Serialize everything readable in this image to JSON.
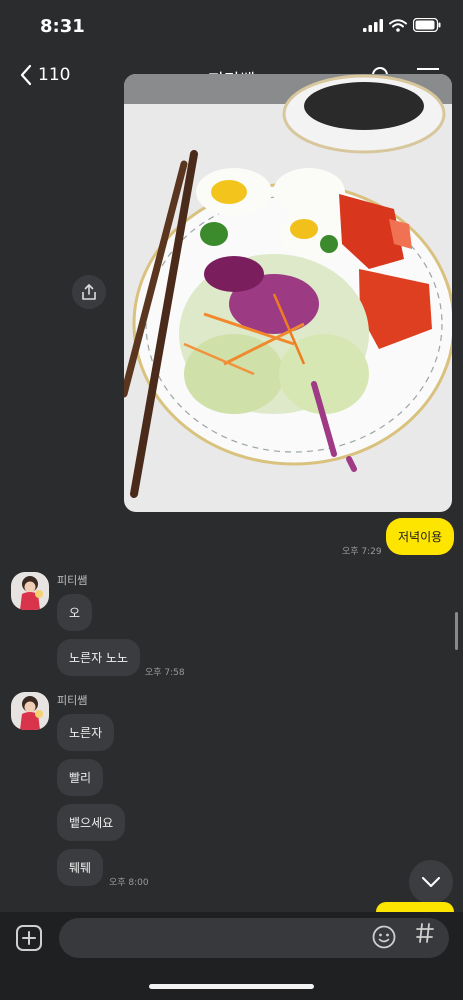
{
  "status_bar": {
    "time": "8:31"
  },
  "header": {
    "back_count": "110",
    "title": "피티쌤",
    "icons": [
      "chevron-left-icon",
      "search-icon",
      "menu-icon"
    ]
  },
  "messages": {
    "mine": {
      "text": "저녁이용",
      "time": "오후 7:29"
    },
    "group1": {
      "sender": "피티쌤",
      "bubbles": [
        "오",
        "노른자 노노"
      ],
      "time": "오후 7:58"
    },
    "group2": {
      "sender": "피티쌤",
      "bubbles": [
        "노른자",
        "빨리",
        "뱉으세요",
        "퉤퉤"
      ],
      "time": "오후 8:00"
    }
  },
  "colors": {
    "accent": "#fee500",
    "background": "#2b2c2e",
    "bubble_other": "#3b3c3f"
  }
}
